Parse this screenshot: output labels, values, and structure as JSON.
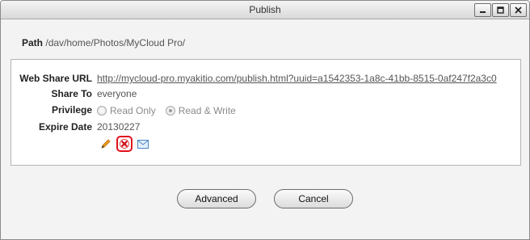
{
  "window": {
    "title": "Publish",
    "controls": [
      "minimize-icon",
      "maximize-icon",
      "close-icon"
    ]
  },
  "path": {
    "label": "Path",
    "value": "/dav/home/Photos/MyCloud Pro/"
  },
  "share": {
    "url_label": "Web Share URL",
    "url_value": "http://mycloud-pro.myakitio.com/publish.html?uuid=a1542353-1a8c-41bb-8515-0af247f2a3c0",
    "share_to_label": "Share To",
    "share_to_value": "everyone",
    "privilege_label": "Privilege",
    "privilege_options": [
      {
        "label": "Read Only",
        "checked": false
      },
      {
        "label": "Read & Write",
        "checked": true
      }
    ],
    "expire_label": "Expire Date",
    "expire_value": "20130227",
    "actions": [
      "pencil-icon",
      "delete-icon",
      "email-icon"
    ]
  },
  "buttons": {
    "advanced": "Advanced",
    "cancel": "Cancel"
  },
  "colors": {
    "link": "#1f3fbf",
    "delete_highlight": "#e3101a"
  }
}
